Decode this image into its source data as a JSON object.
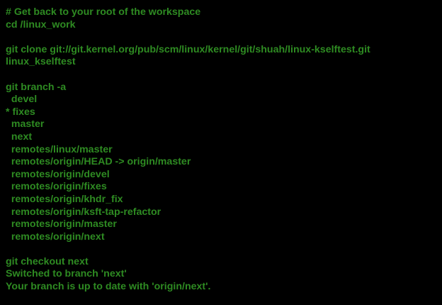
{
  "colors": {
    "background": "#000000",
    "text": "#2e8b22"
  },
  "terminal": {
    "lines": [
      "# Get back to your root of the workspace",
      "cd /linux_work",
      "",
      "git clone git://git.kernel.org/pub/scm/linux/kernel/git/shuah/linux-kselftest.git",
      "linux_kselftest",
      "",
      "git branch -a",
      "  devel",
      "* fixes",
      "  master",
      "  next",
      "  remotes/linux/master",
      "  remotes/origin/HEAD -> origin/master",
      "  remotes/origin/devel",
      "  remotes/origin/fixes",
      "  remotes/origin/khdr_fix",
      "  remotes/origin/ksft-tap-refactor",
      "  remotes/origin/master",
      "  remotes/origin/next",
      "",
      "git checkout next",
      "Switched to branch 'next'",
      "Your branch is up to date with 'origin/next'."
    ]
  }
}
